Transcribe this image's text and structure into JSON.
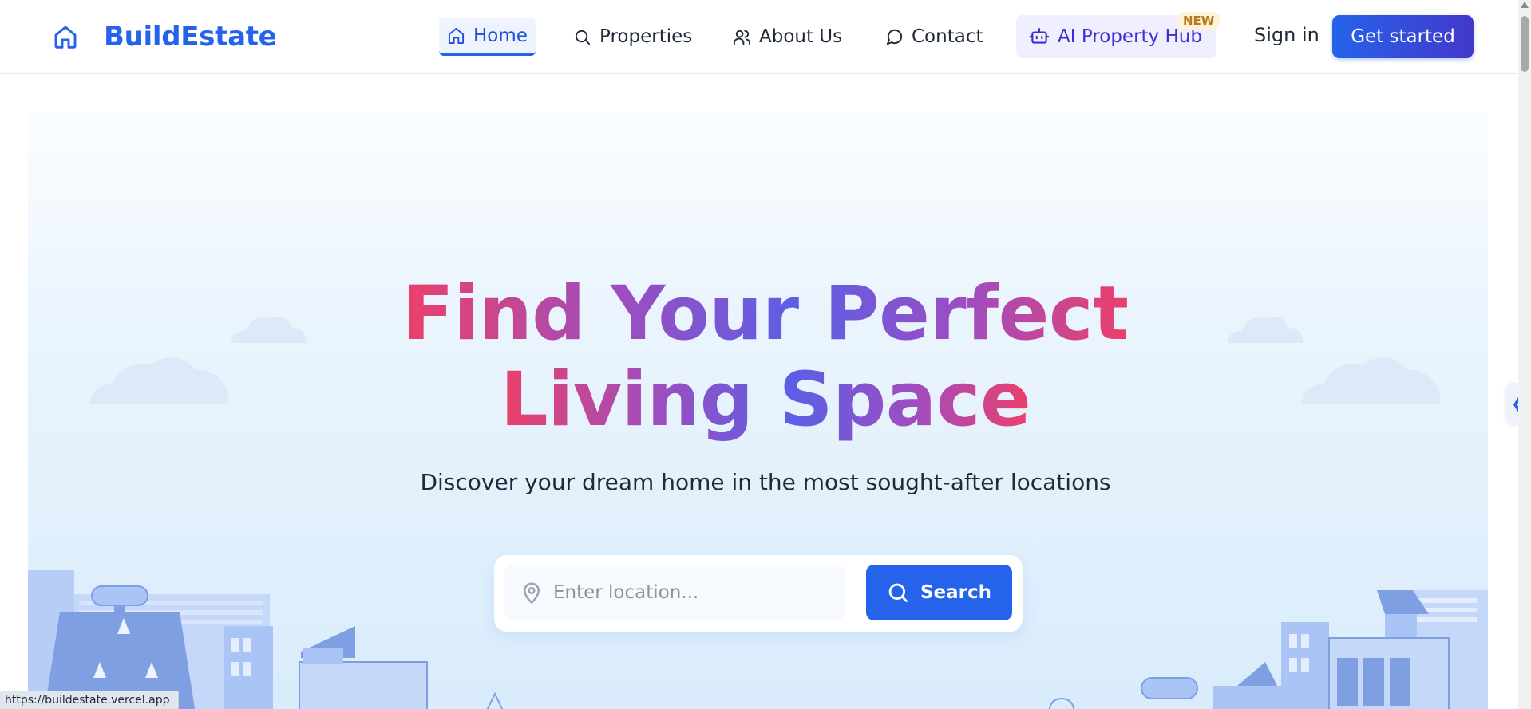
{
  "brand": {
    "name": "BuildEstate",
    "logo_icon": "home-icon",
    "color": "#2563eb"
  },
  "nav": {
    "home": "Home",
    "properties": "Properties",
    "about": "About Us",
    "contact": "Contact",
    "ai_hub": "AI Property Hub",
    "ai_badge": "NEW",
    "signin": "Sign in",
    "get_started": "Get started"
  },
  "hero": {
    "headline_line1": "Find Your Perfect",
    "headline_line2": "Living Space",
    "subtitle": "Discover your dream home in the most sought-after locations",
    "search": {
      "placeholder": "Enter location...",
      "value": "",
      "button_label": "Search"
    }
  },
  "status_bar": {
    "url": "https://buildestate.vercel.app"
  },
  "colors": {
    "primary": "#2563eb",
    "gradient_pink": "#ec4069",
    "gradient_purple": "#5b5fe6",
    "ai_text": "#3b2fd1",
    "badge": "#b7791f"
  }
}
